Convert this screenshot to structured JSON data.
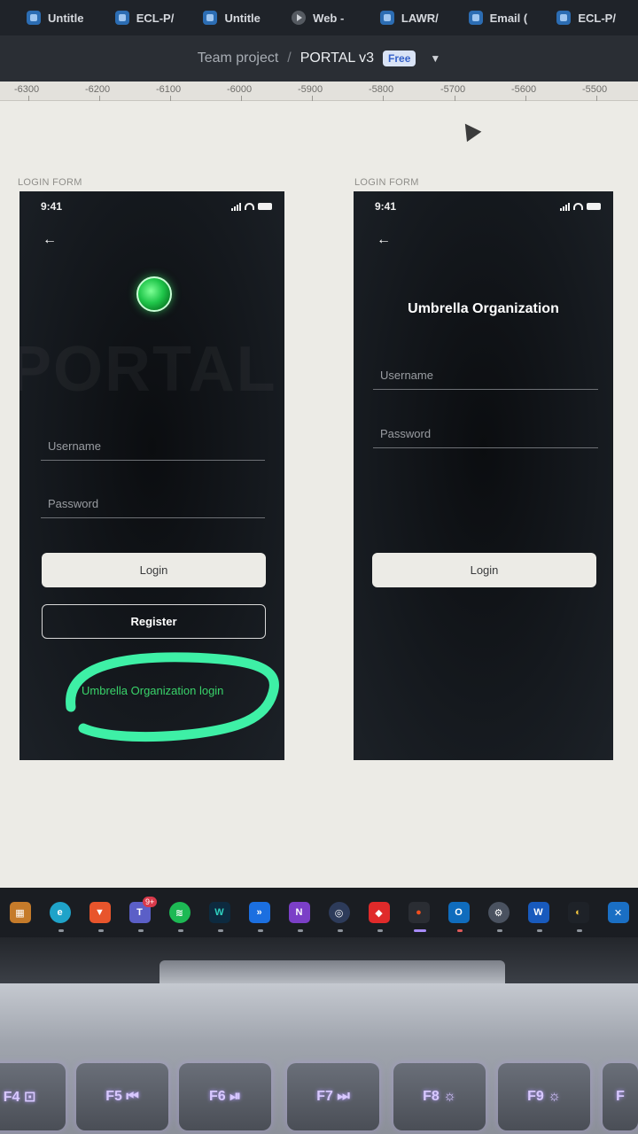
{
  "browser_tabs": [
    {
      "label": "Untitle",
      "icon": "figma-doc-icon"
    },
    {
      "label": "ECL-P/",
      "icon": "figma-doc-icon"
    },
    {
      "label": "Untitle",
      "icon": "figma-doc-icon"
    },
    {
      "label": "Web -",
      "icon": "play-icon"
    },
    {
      "label": "LAWR/",
      "icon": "figma-doc-icon"
    },
    {
      "label": "Email (",
      "icon": "figma-doc-icon"
    },
    {
      "label": "ECL-P/",
      "icon": "figma-doc-icon"
    }
  ],
  "header": {
    "team": "Team project",
    "separator": "/",
    "file_name": "PORTAL v3",
    "plan_badge": "Free",
    "menu_icon": "chevron-down-icon"
  },
  "ruler": {
    "labels": [
      "-6300",
      "-6200",
      "-6100",
      "-6000",
      "-5900",
      "-5800",
      "-5700",
      "-5600",
      "-5500"
    ]
  },
  "frames": [
    {
      "label": "LOGIN FORM",
      "status_time": "9:41",
      "back_icon": "arrow-left-icon",
      "watermark": "PORTAL",
      "username_placeholder": "Username",
      "password_placeholder": "Password",
      "login_label": "Login",
      "register_label": "Register",
      "org_link": "Umbrella Organization login"
    },
    {
      "label": "LOGIN FORM",
      "status_time": "9:41",
      "back_icon": "arrow-left-icon",
      "title": "Umbrella Organization",
      "username_placeholder": "Username",
      "password_placeholder": "Password",
      "login_label": "Login"
    }
  ],
  "taskbar": {
    "apps": [
      {
        "name": "store",
        "badge": ""
      },
      {
        "name": "edge",
        "badge": ""
      },
      {
        "name": "brave",
        "badge": ""
      },
      {
        "name": "teams",
        "badge": "9+"
      },
      {
        "name": "spotify",
        "badge": ""
      },
      {
        "name": "webex",
        "badge": ""
      },
      {
        "name": "azure",
        "badge": ""
      },
      {
        "name": "visual-studio",
        "badge": ""
      },
      {
        "name": "obs",
        "badge": ""
      },
      {
        "name": "anydesk",
        "badge": ""
      },
      {
        "name": "figma",
        "badge": ""
      },
      {
        "name": "outlook",
        "badge": ""
      },
      {
        "name": "settings",
        "badge": ""
      },
      {
        "name": "word",
        "badge": ""
      },
      {
        "name": "penguin",
        "badge": ""
      },
      {
        "name": "vscode",
        "badge": ""
      }
    ]
  },
  "keyboard": {
    "keys": [
      "F4 ⊡",
      "F5 ⏮",
      "F6 ⏯",
      "F7 ⏭",
      "F8 ☼",
      "F9 ☼",
      "F"
    ]
  },
  "colors": {
    "accent_green": "#39d36a",
    "marker": "#3ef0a6",
    "figma_badge": "#3561c9",
    "phone_bg": "#0f1216"
  }
}
